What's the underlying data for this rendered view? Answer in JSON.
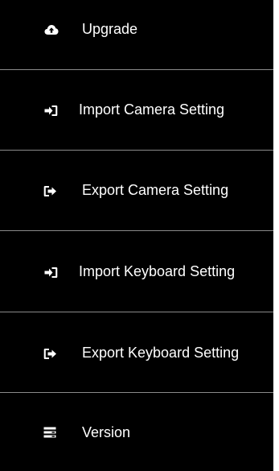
{
  "menu": {
    "items": [
      {
        "label": "Upgrade",
        "icon": "cloud-upload-icon"
      },
      {
        "label": "Import Camera Setting",
        "icon": "import-icon"
      },
      {
        "label": "Export Camera Setting",
        "icon": "export-icon"
      },
      {
        "label": "Import Keyboard Setting",
        "icon": "import-icon"
      },
      {
        "label": "Export Keyboard Setting",
        "icon": "export-icon"
      },
      {
        "label": "Version",
        "icon": "version-icon"
      }
    ]
  },
  "colors": {
    "background": "#000000",
    "text": "#ffffff",
    "divider": "#8a8a8a"
  }
}
